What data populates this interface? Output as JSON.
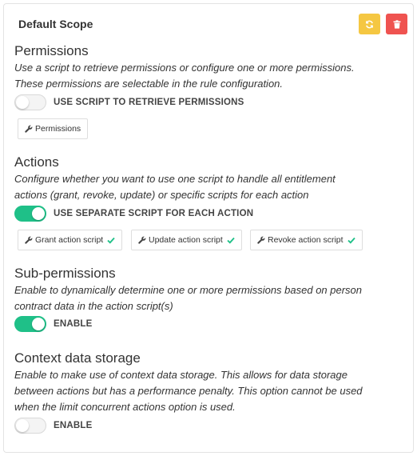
{
  "panel": {
    "title": "Default Scope",
    "refresh_icon": "refresh-icon",
    "delete_icon": "trash-icon",
    "colors": {
      "refresh": "#f5c742",
      "delete": "#ef5350",
      "toggle_on": "#1fc088",
      "check": "#1fc088"
    }
  },
  "permissions": {
    "title": "Permissions",
    "desc1": "Use a script to retrieve permissions or configure one or more permissions.",
    "desc2": "These permissions are selectable in the rule configuration.",
    "toggle_label": "USE SCRIPT TO RETRIEVE PERMISSIONS",
    "toggle_on": false,
    "button_label": "Permissions"
  },
  "actions": {
    "title": "Actions",
    "desc1": "Configure whether you want to use one script to handle all entitlement",
    "desc2": "actions (grant, revoke, update) or specific scripts for each action",
    "toggle_label": "USE SEPARATE SCRIPT FOR EACH ACTION",
    "toggle_on": true,
    "buttons": [
      {
        "label": "Grant action script",
        "checked": true
      },
      {
        "label": "Update action script",
        "checked": true
      },
      {
        "label": "Revoke action script",
        "checked": true
      }
    ]
  },
  "sub_permissions": {
    "title": "Sub-permissions",
    "desc1": "Enable to dynamically determine one or more permissions based on person",
    "desc2": "contract data in the action script(s)",
    "toggle_label": "ENABLE",
    "toggle_on": true
  },
  "context_storage": {
    "title": "Context data storage",
    "desc1": "Enable to make use of context data storage. This allows for data storage",
    "desc2": "between actions but has a performance penalty. This option cannot be used",
    "desc3": "when the limit concurrent actions option is used.",
    "toggle_label": "ENABLE",
    "toggle_on": false
  }
}
